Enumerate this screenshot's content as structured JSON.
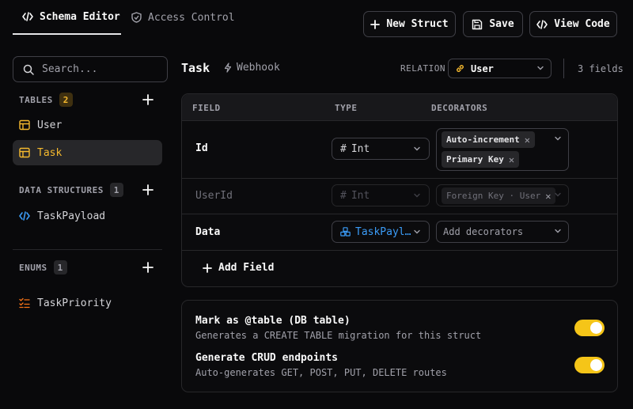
{
  "tabs": [
    {
      "label": "Schema Editor",
      "icon": "code-icon",
      "active": true
    },
    {
      "label": "Access Control",
      "icon": "shield-icon",
      "active": false
    }
  ],
  "toolbar": {
    "new_struct": "New Struct",
    "save": "Save",
    "view_code": "View Code"
  },
  "sidebar": {
    "search_placeholder": "Search...",
    "tables": {
      "title": "TABLES",
      "count": "2",
      "items": [
        {
          "label": "User"
        },
        {
          "label": "Task"
        }
      ]
    },
    "data_structures": {
      "title": "DATA STRUCTURES",
      "count": "1",
      "items": [
        {
          "label": "TaskPayload"
        }
      ]
    },
    "enums": {
      "title": "ENUMS",
      "count": "1",
      "items": [
        {
          "label": "TaskPriority"
        }
      ]
    }
  },
  "main": {
    "struct_name": "Task",
    "webhook_label": "Webhook",
    "relation_label": "RELATION",
    "relation_value": "User",
    "field_count": "3 fields",
    "columns": [
      "FIELD",
      "TYPE",
      "DECORATORS"
    ],
    "fields": [
      {
        "name": "Id",
        "type": "Int",
        "type_icon": "#",
        "decorators": [
          "Auto-increment",
          "Primary Key"
        ]
      },
      {
        "name": "UserId",
        "type": "Int",
        "type_icon": "#",
        "decorators": [
          "Foreign Key · User"
        ]
      },
      {
        "name": "Data",
        "type": "TaskPayl…",
        "decorators_placeholder": "Add decorators"
      }
    ],
    "add_field": "Add Field",
    "options": [
      {
        "title": "Mark as @table (DB table)",
        "description": "Generates a CREATE TABLE migration for this struct",
        "enabled": true
      },
      {
        "title": "Generate CRUD endpoints",
        "description": "Auto-generates GET, POST, PUT, DELETE routes",
        "enabled": true
      }
    ]
  },
  "colors": {
    "accent": "#f5c518",
    "active_item": "#f5b92e",
    "type_link": "#3b9cf7",
    "background": "#09090b"
  }
}
